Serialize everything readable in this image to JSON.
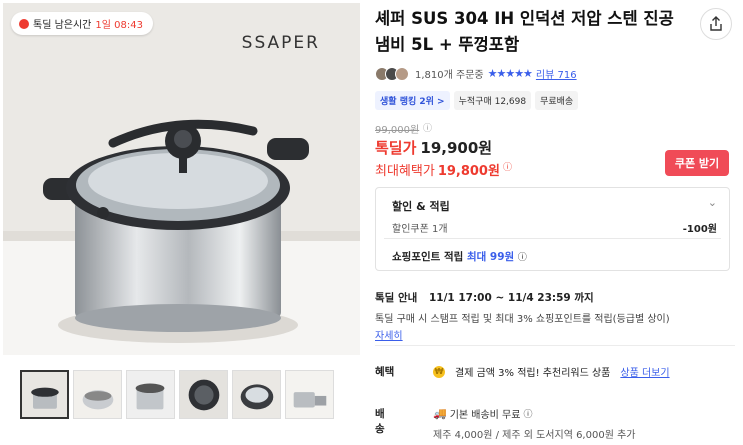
{
  "gallery": {
    "deal_label": "톡딜 남은시간",
    "deal_time": "1일 08:43",
    "brand_text": "SSAPER",
    "thumbnails": [
      "pot-front",
      "pot-cooking",
      "pot-open",
      "pot-top",
      "pot-lid",
      "pot-set"
    ]
  },
  "product": {
    "title": "셰퍼 SUS 304 IH 인덕션 저압 스텐 진공냄비 5L + 뚜껑포함",
    "order_count": "1,810개 주문중",
    "stars": "★★★★★",
    "review": "리뷰 716",
    "tags": [
      "생활 랭킹 2위 >",
      "누적구매 12,698",
      "무료배송"
    ],
    "original_price": "99,000원",
    "sale_label": "톡딜가",
    "sale_price": "19,900원",
    "max_label": "최대혜택가",
    "max_price": "19,800원",
    "coupon_button": "쿠폰 받기"
  },
  "discount": {
    "header": "할인 & 적립",
    "coupon_label": "할인쿠폰 1개",
    "coupon_value": "-100원",
    "point_label": "쇼핑포인트 적립",
    "point_value": "최대 99원"
  },
  "notice": {
    "label": "톡딜 안내",
    "period": "11/1 17:00 ~ 11/4 23:59 까지",
    "desc": "톡딜 구매 시 스탬프 적립 및 최대 3% 쇼핑포인트를 적립(등급별 상이)",
    "more": "자세히"
  },
  "benefit": {
    "label": "혜택",
    "text": "결제 금액 3% 적립! 추천리워드 상품",
    "link": "상품 더보기"
  },
  "shipping": {
    "label": "배송",
    "line1": "기본 배송비 무료",
    "line2": "제주 4,000원 / 제주 외 도서지역 6,000원 추가"
  },
  "colors": {
    "accent_red": "#ee3a2f",
    "accent_blue": "#3a5eea",
    "coupon_bg": "#f04b57"
  }
}
